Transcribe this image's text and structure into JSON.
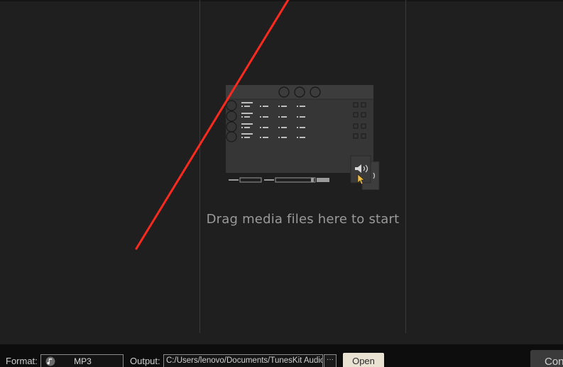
{
  "main": {
    "drop_hint": "Drag media files here to start"
  },
  "bottom_bar": {
    "format_label": "Format:",
    "format_value": "MP3",
    "format_icon": "audio-format-icon",
    "output_label": "Output:",
    "output_path": "C:/Users/lenovo/Documents/TunesKit Audio Converter",
    "browse_label": "···",
    "open_label": "Open",
    "convert_label": "Con"
  },
  "colors": {
    "background": "#1f1f1f",
    "annotation": "#ff2a1f",
    "open_button": "#e9e2d3"
  }
}
